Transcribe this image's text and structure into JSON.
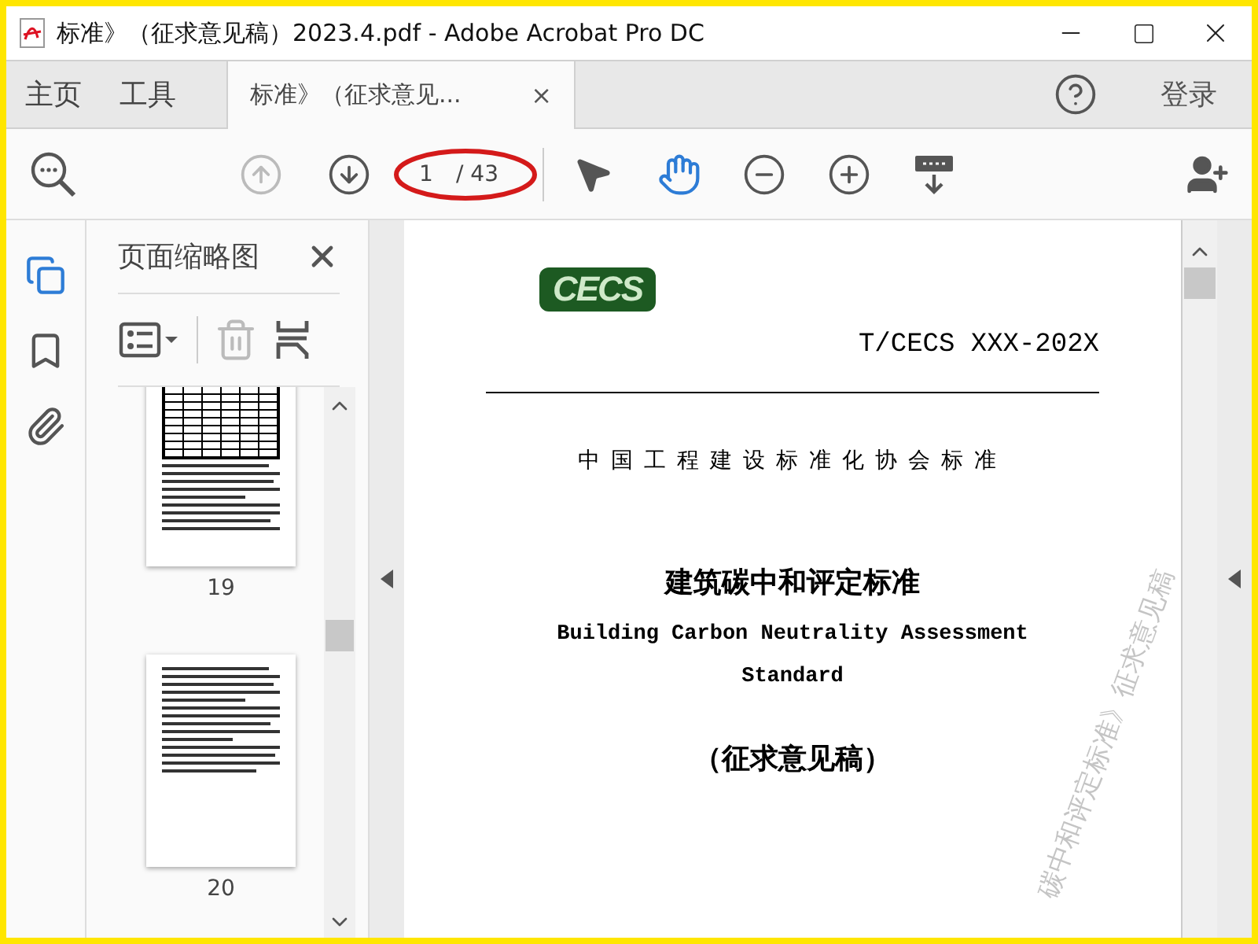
{
  "window": {
    "title": "标准》（征求意见稿）2023.4.pdf - Adobe Acrobat Pro DC"
  },
  "tabs": [
    {
      "label": "主页",
      "kind": "home",
      "selected": false
    },
    {
      "label": "工具",
      "kind": "tools",
      "selected": false
    },
    {
      "label": "标准》（征求意见...",
      "kind": "document",
      "selected": true,
      "close": "×"
    }
  ],
  "account": {
    "sign_in": "登录"
  },
  "toolbar": {
    "page_number": "1",
    "page_total": "/ 43",
    "previous_disabled": true,
    "page_circled": true,
    "tools": [
      {
        "kind": "select",
        "selected": false
      },
      {
        "kind": "hand",
        "selected": true
      }
    ]
  },
  "rail": [
    {
      "kind": "pages",
      "selected": true
    },
    {
      "kind": "bookmarks",
      "selected": false
    },
    {
      "kind": "attachments",
      "selected": false
    }
  ],
  "panel": {
    "title": "页面缩略图",
    "delete_disabled": true,
    "thumbnails": [
      {
        "label": "19",
        "kind": "table",
        "selected": false
      },
      {
        "label": "20",
        "kind": "text",
        "selected": false
      }
    ]
  },
  "document": {
    "logo": "CECS",
    "code": "T/CECS XXX-202X",
    "organization": "中国工程建设标准化协会标准",
    "title_zh": "建筑碳中和评定标准",
    "title_en": "Building Carbon Neutrality Assessment Standard",
    "subtitle": "（征求意见稿）",
    "watermark": "碳中和评定标准》征求意见稿"
  }
}
